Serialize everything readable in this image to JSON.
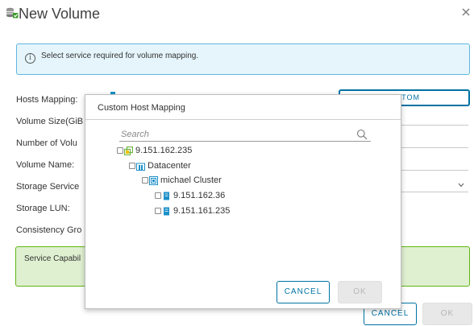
{
  "dialog": {
    "title": "New Volume",
    "info_message": "Select service required for volume mapping."
  },
  "form": {
    "hosts_mapping_label": "Hosts Mapping:",
    "custom_button_label": "STOM",
    "volume_size_label": "Volume Size(GiB",
    "number_of_volumes_label": "Number of Volu",
    "volume_name_label": "Volume Name:",
    "storage_service_label": "Storage Service",
    "storage_lun_label": "Storage LUN:",
    "consistency_group_label": "Consistency Gro",
    "service_capabilities_label": "Service Capabil"
  },
  "footer": {
    "cancel_label": "CANCEL",
    "ok_label": "OK"
  },
  "modal": {
    "title": "Custom Host Mapping",
    "search_placeholder": "Search",
    "tree": {
      "root": "9.151.162.235",
      "datacenter": "Datacenter",
      "cluster": "michael Cluster",
      "hosts": [
        "9.151.162.36",
        "9.151.161.235"
      ]
    },
    "cancel_label": "CANCEL",
    "ok_label": "OK"
  },
  "colors": {
    "accent": "#0072a3",
    "info_bg": "#e5f5fb",
    "info_border": "#5fb7df",
    "success_bg": "#dff0d0",
    "success_border": "#60b515",
    "disabled_bg": "#e8e8e8",
    "tree_icon": "#1b8fc7",
    "vcenter_icon": "#6db33f"
  },
  "icons": {
    "title": "volume-stack-icon",
    "close": "close-icon",
    "info": "info-icon",
    "search": "search-icon",
    "vcenter": "vcenter-icon",
    "datacenter": "datacenter-icon",
    "cluster": "cluster-icon",
    "host": "host-icon",
    "dropdown": "chevron-down-icon"
  }
}
